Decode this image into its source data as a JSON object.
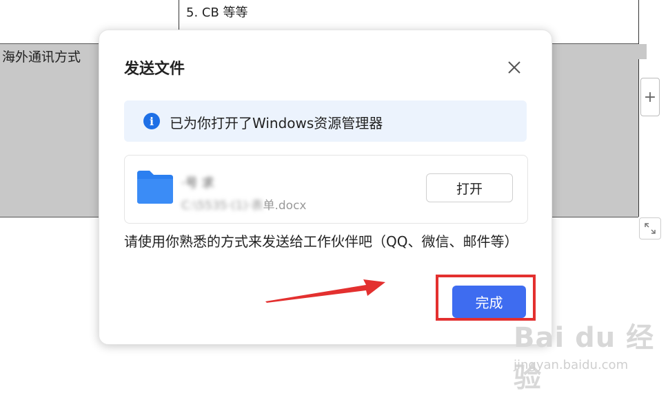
{
  "background": {
    "list_item": "5.   CB 等等",
    "row_label": "海外通讯方式",
    "side_button": "+"
  },
  "dialog": {
    "title": "发送文件",
    "info_text": "已为你打开了Windows资源管理器",
    "file": {
      "name_blurred": "·号 求",
      "path_blurred": "C:\\5535·(1)·表",
      "path_visible": "单.docx",
      "icon": "folder-icon"
    },
    "open_label": "打开",
    "hint": "请使用你熟悉的方式来发送给工作伙伴吧（QQ、微信、邮件等）",
    "done_label": "完成"
  },
  "colors": {
    "accent": "#3e6cf0",
    "info_bg": "#ecf3fd",
    "info_icon": "#1e6fe6",
    "folder": "#2b7ff0",
    "annotation": "#e3302f"
  },
  "watermark": {
    "logo": "Bai du 经验",
    "url": "jingyan.baidu.com"
  }
}
